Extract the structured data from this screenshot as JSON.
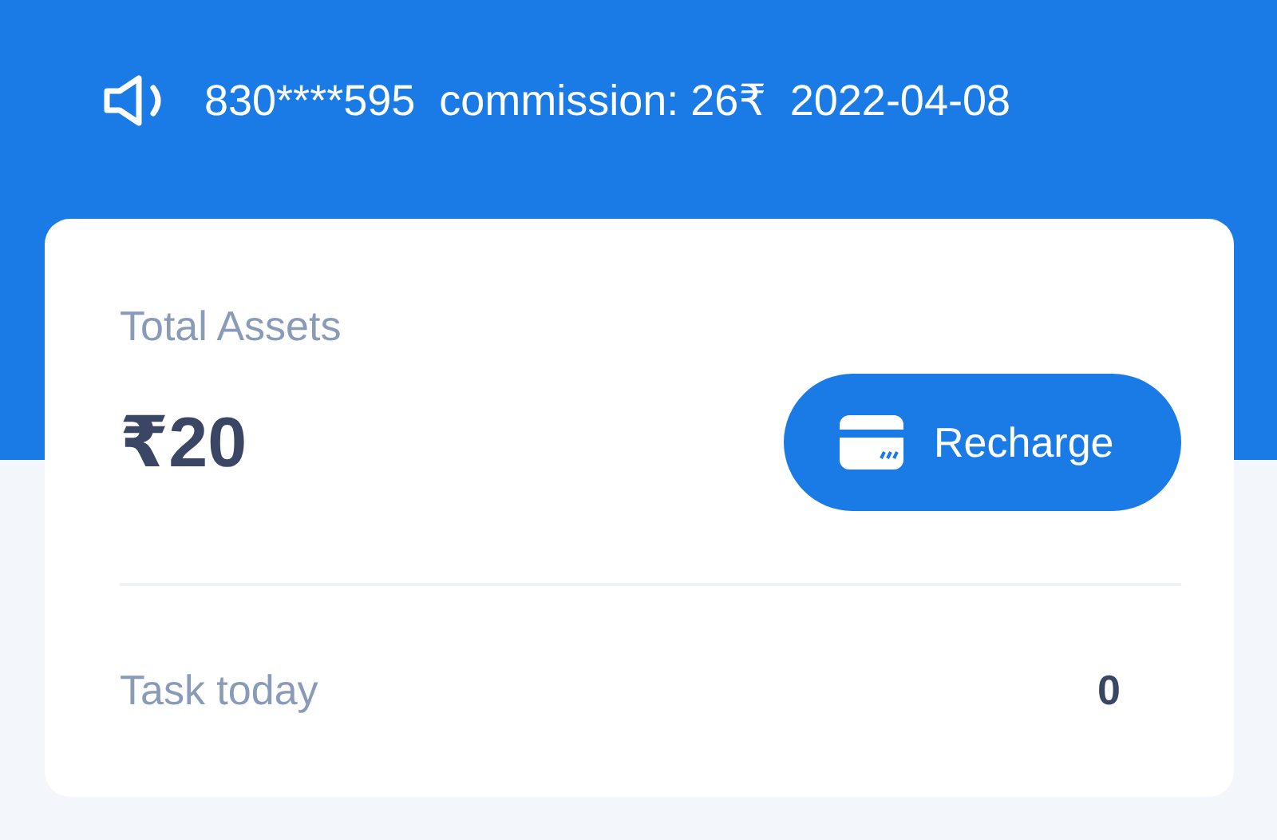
{
  "notice": {
    "text": "830****595  commission: 26₹  2022-04-08"
  },
  "assets": {
    "label": "Total Assets",
    "amount": "₹20",
    "button": "Recharge"
  },
  "task": {
    "label": "Task today",
    "count": "0"
  }
}
